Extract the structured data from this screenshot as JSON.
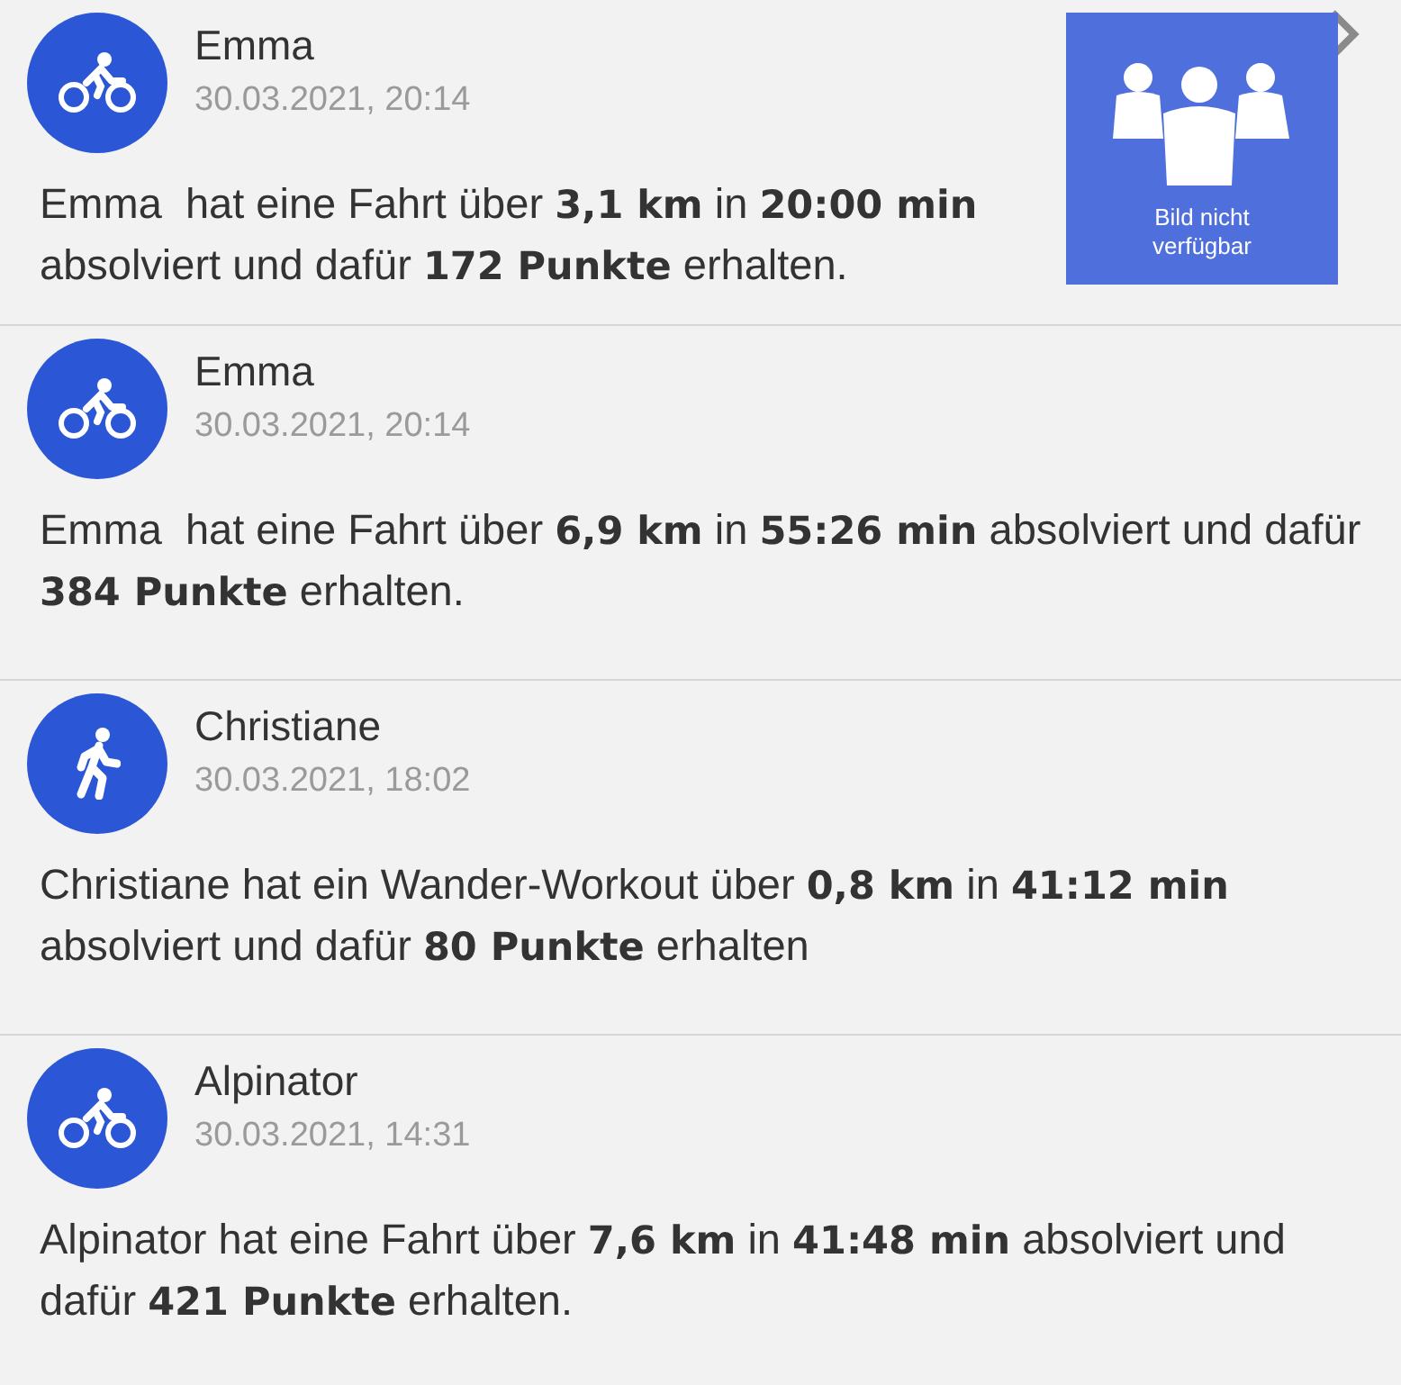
{
  "feed": [
    {
      "kind": "bike",
      "name": "Emma",
      "time": "30.03.2021, 20:14",
      "text": "Emma  hat eine Fahrt über **3,1 km** in **20:00 min** absolviert und dafür **172 Punkte** erhalten.",
      "image": {
        "kind": "picture",
        "caption": "Bild nicht verfügbar"
      }
    },
    {
      "kind": "bike",
      "name": "Emma",
      "time": "30.03.2021, 20:14",
      "text": "Emma  hat eine Fahrt über **6,9 km** in **55:26 min** absolviert und dafür **384 Punkte** erhalten."
    },
    {
      "kind": "walk",
      "name": "Christiane",
      "time": "30.03.2021, 18:02",
      "text": "Christiane hat ein Wander-Workout über **0,8 km** in **41:12 min** absolviert und dafür **80 Punkte** erhalten"
    },
    {
      "kind": "bike",
      "name": "Alpinator",
      "time": "30.03.2021, 14:31",
      "text": "Alpinator hat eine Fahrt über **7,6 km** in **41:48 min** absolviert und dafür **421 Punkte** erhalten."
    }
  ]
}
